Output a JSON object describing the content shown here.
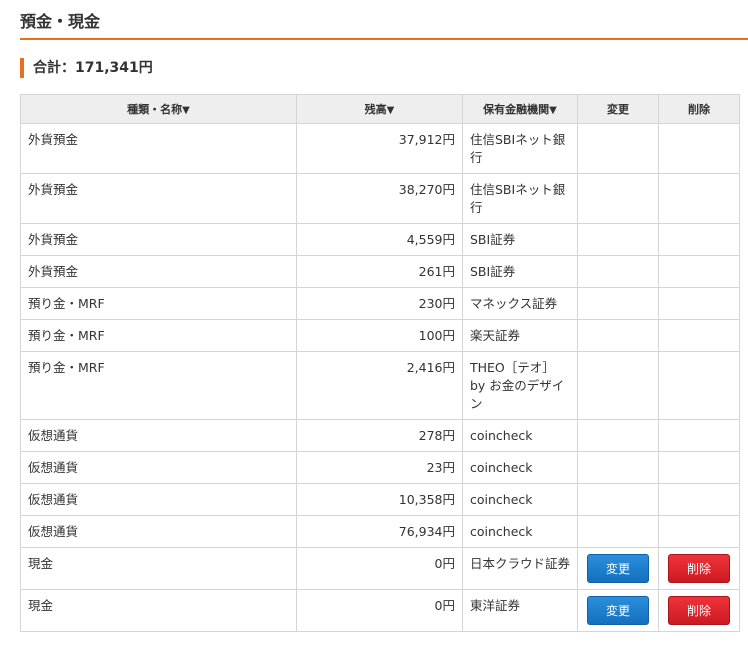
{
  "section": {
    "title": "預金・現金"
  },
  "summary": {
    "total_label": "合計：171,341円"
  },
  "table": {
    "headers": {
      "type": "種類・名称",
      "balance": "残高",
      "institution": "保有金融機関",
      "edit": "変更",
      "delete": "削除",
      "sort_arrow": "▼"
    },
    "rows": [
      {
        "type": "外貨預金",
        "balance": "37,912円",
        "institution": "住信SBIネット銀行"
      },
      {
        "type": "外貨預金",
        "balance": "38,270円",
        "institution": "住信SBIネット銀行"
      },
      {
        "type": "外貨預金",
        "balance": "4,559円",
        "institution": "SBI証券"
      },
      {
        "type": "外貨預金",
        "balance": "261円",
        "institution": "SBI証券"
      },
      {
        "type": "預り金・MRF",
        "balance": "230円",
        "institution": "マネックス証券"
      },
      {
        "type": "預り金・MRF",
        "balance": "100円",
        "institution": "楽天証券"
      },
      {
        "type": "預り金・MRF",
        "balance": "2,416円",
        "institution": "THEO［テオ］by お金のデザイン"
      },
      {
        "type": "仮想通貨",
        "balance": "278円",
        "institution": "coincheck"
      },
      {
        "type": "仮想通貨",
        "balance": "23円",
        "institution": "coincheck"
      },
      {
        "type": "仮想通貨",
        "balance": "10,358円",
        "institution": "coincheck"
      },
      {
        "type": "仮想通貨",
        "balance": "76,934円",
        "institution": "coincheck"
      },
      {
        "type": "現金",
        "balance": "0円",
        "institution": "日本クラウド証券",
        "edit_label": "変更",
        "delete_label": "削除"
      },
      {
        "type": "現金",
        "balance": "0円",
        "institution": "東洋証券",
        "edit_label": "変更",
        "delete_label": "削除"
      }
    ]
  },
  "colors": {
    "accent": "#e86f1b",
    "edit_button": "#1a7acb",
    "delete_button": "#e0242c"
  }
}
